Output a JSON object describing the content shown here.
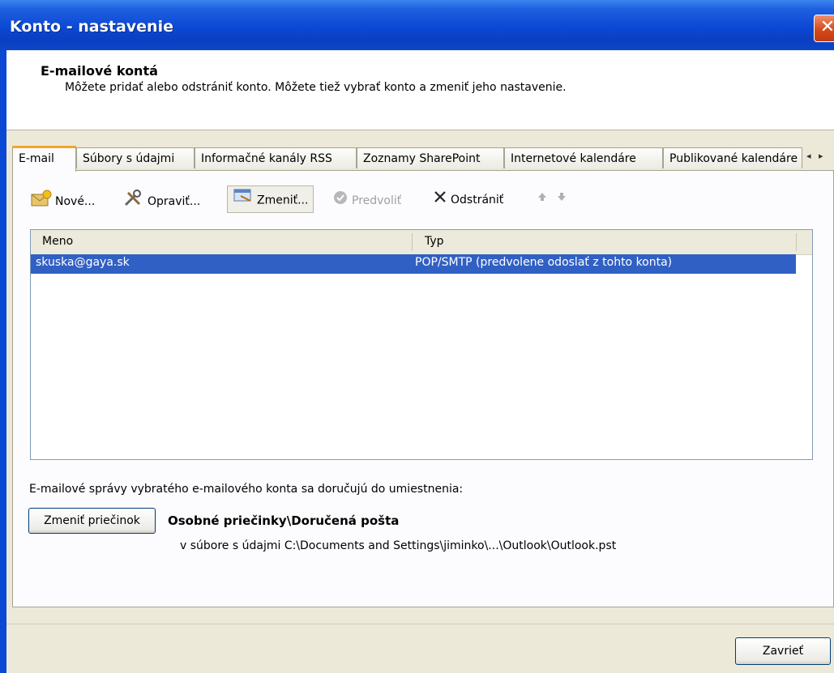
{
  "window": {
    "title": "Konto - nastavenie",
    "close_glyph": "✕"
  },
  "header": {
    "title": "E-mailové kontá",
    "description": "Môžete pridať alebo odstrániť konto. Môžete tiež vybrať konto a zmeniť jeho nastavenie."
  },
  "tabs": [
    {
      "label": "E-mail",
      "active": true
    },
    {
      "label": "Súbory s údajmi"
    },
    {
      "label": "Informačné kanály RSS"
    },
    {
      "label": "Zoznamy SharePoint"
    },
    {
      "label": "Internetové kalendáre"
    },
    {
      "label": "Publikované kalendáre"
    }
  ],
  "tab_scroll": "◂ ▸",
  "toolbar": {
    "new": {
      "label": "Nové...",
      "icon": "new-account-icon"
    },
    "repair": {
      "label": "Opraviť...",
      "icon": "repair-icon"
    },
    "change": {
      "label": "Zmeniť...",
      "icon": "change-icon"
    },
    "default": {
      "label": "Predvoliť",
      "icon": "check-icon",
      "disabled": true
    },
    "remove": {
      "label": "Odstrániť",
      "icon": "remove-icon"
    },
    "move_up": {
      "icon": "arrow-up-icon"
    },
    "move_down": {
      "icon": "arrow-down-icon"
    }
  },
  "accounts": {
    "columns": [
      "Meno",
      "Typ"
    ],
    "rows": [
      {
        "name": "skuska@gaya.sk",
        "type": "POP/SMTP (predvolene odoslať z tohto konta)",
        "selected": true
      }
    ]
  },
  "delivery": {
    "info": "E-mailové správy vybratého e-mailového konta sa doručujú do umiestnenia:",
    "change_folder_button": "Zmeniť priečinok",
    "folder": "Osobné priečinky\\Doručená pošta",
    "path": "v súbore s údajmi C:\\Documents and Settings\\jiminko\\...\\Outlook\\Outlook.pst"
  },
  "footer": {
    "close_button": "Zavrieť"
  },
  "colors": {
    "selection": "#3160c4",
    "titlebar": "#0b48d4",
    "tab_accent": "#f3a626"
  }
}
